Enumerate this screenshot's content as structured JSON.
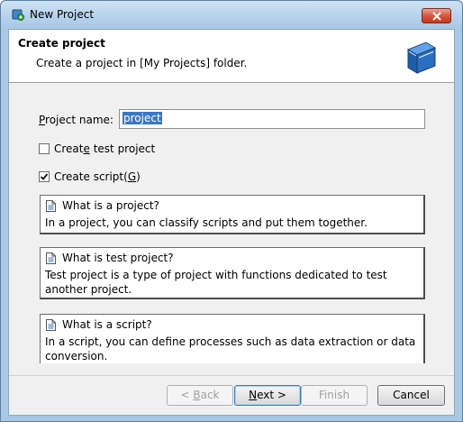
{
  "window": {
    "title": "New Project"
  },
  "header": {
    "title": "Create project",
    "description": "Create a project in [My Projects] folder."
  },
  "form": {
    "project_name": {
      "label_prefix": "",
      "label_mnemonic": "P",
      "label_rest": "roject name:",
      "value": "project"
    },
    "create_test_project": {
      "label_pre": "Creat",
      "label_mnemonic": "e",
      "label_post": " test project",
      "checked": false
    },
    "create_script": {
      "label_pre": "Create script(",
      "label_mnemonic": "G",
      "label_post": ")",
      "checked": true
    }
  },
  "info_boxes": [
    {
      "title": "What is a project?",
      "body": "In a project, you can classify scripts and put them together."
    },
    {
      "title": "What is test project?",
      "body": "Test project is a type of project with functions dedicated to test another project."
    },
    {
      "title": "What is a script?",
      "body": "In a script, you can define processes such as data extraction or data conversion."
    }
  ],
  "buttons": {
    "back": {
      "pre": "< ",
      "mnemonic": "B",
      "post": "ack",
      "enabled": false
    },
    "next": {
      "pre": "",
      "mnemonic": "N",
      "post": "ext >",
      "enabled": true
    },
    "finish": {
      "label": "Finish",
      "enabled": false
    },
    "cancel": {
      "label": "Cancel",
      "enabled": true
    }
  },
  "icons": {
    "app": "new-project-icon",
    "header": "book-icon",
    "info": "document-icon",
    "close": "close-icon"
  },
  "colors": {
    "title_bar": "#b7d2ec",
    "selection": "#3b77c3",
    "close_button": "#c33a22",
    "book": "#2a6fc0"
  }
}
